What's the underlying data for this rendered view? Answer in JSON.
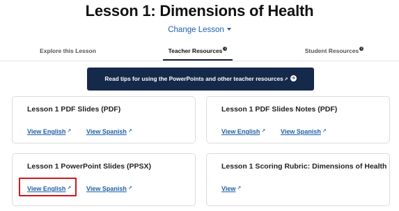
{
  "page": {
    "title": "Lesson 1: Dimensions of Health",
    "change_lesson": "Change Lesson"
  },
  "tabs": [
    {
      "label": "Explore this Lesson",
      "active": false,
      "info": false
    },
    {
      "label": "Teacher Resources",
      "active": true,
      "info": true
    },
    {
      "label": "Student Resources",
      "active": false,
      "info": true
    }
  ],
  "banner": {
    "label": "Read tips for using the PowerPoints and other teacher resources"
  },
  "cards": [
    {
      "title": "Lesson 1 PDF Slides (PDF)",
      "links": [
        "View English",
        "View Spanish"
      ]
    },
    {
      "title": "Lesson 1 PDF Slides Notes (PDF)",
      "links": [
        "View English",
        "View Spanish"
      ]
    },
    {
      "title": "Lesson 1 PowerPoint Slides (PPSX)",
      "links": [
        "View English",
        "View Spanish"
      ],
      "highlighted_link": "View English"
    },
    {
      "title": "Lesson 1 Scoring Rubric: Dimensions of Health",
      "links": [
        "View"
      ]
    }
  ],
  "icons": {
    "external_link": "external-link-icon",
    "info": "info-icon",
    "arrow": "arrow-right-circle-icon",
    "caret": "caret-down-icon"
  },
  "colors": {
    "banner_bg": "#15294b",
    "link": "#1f5fa6",
    "highlight": "#d0181c"
  }
}
